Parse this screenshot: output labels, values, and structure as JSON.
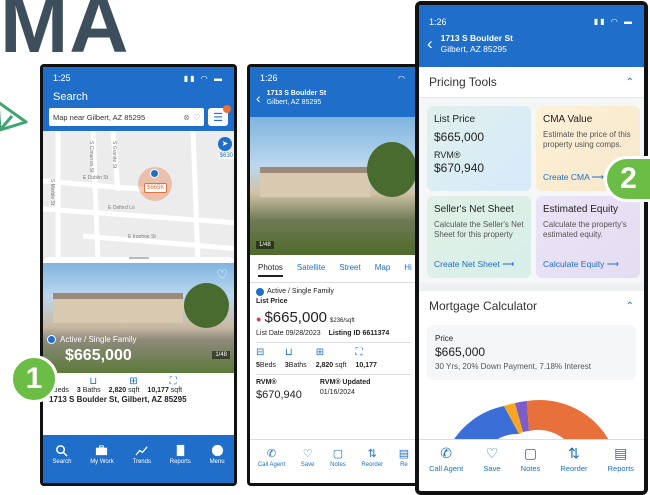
{
  "hero_title": "MA",
  "phone1": {
    "time": "1:25",
    "title": "Search",
    "search_text": "Map near Gilbert, AZ 85295",
    "filter_badge": "1",
    "map": {
      "price_pin": "$665K",
      "side_pin": "$630",
      "streets": [
        "S Granite St",
        "S Cimarron St",
        "S Marble St",
        "E Dublin St",
        "E Oxford Ln",
        "E Ironhoe St"
      ]
    },
    "listing": {
      "status": "Active / Single Family",
      "price": "$665,000",
      "photo_count": "1/48",
      "beds": "5",
      "beds_label": "Beds",
      "baths": "3",
      "baths_label": "Baths",
      "sqft": "2,820",
      "sqft_label": "sqft",
      "lot": "10,177",
      "lot_label": "sqft",
      "address": "1713 S Boulder St, Gilbert, AZ 85295"
    },
    "tabs": [
      "Search",
      "My Work",
      "Trends",
      "Reports",
      "Menu"
    ],
    "callout": "1"
  },
  "phone2": {
    "time": "1:26",
    "addr1": "1713 S Boulder St",
    "addr2": "Gilbert, AZ 85295",
    "photo_count": "1/48",
    "media_tabs": [
      "Photos",
      "Satellite",
      "Street",
      "Map",
      "Hi"
    ],
    "status": "Active / Single Family",
    "list_price_label": "List Price",
    "price": "$665,000",
    "per_sqft": "$236/sqft",
    "list_date": "List Date 09/28/2023",
    "listing_id": "Listing ID 6611374",
    "beds": "5",
    "beds_label": "Beds",
    "baths": "3",
    "baths_label": "Baths",
    "sqft": "2,820",
    "sqft_label": "sqft",
    "lot": "10,177",
    "rvm_label": "RVM®",
    "rvm_value": "$670,940",
    "rvm_updated_label": "RVM® Updated",
    "rvm_updated_date": "01/16/2024",
    "actions": [
      "Call Agent",
      "Save",
      "Notes",
      "Reorder",
      "Re"
    ]
  },
  "phone3": {
    "time": "1:26",
    "addr1": "1713 S Boulder St",
    "addr2": "Gilbert, AZ 85295",
    "pricing_tools": "Pricing Tools",
    "list_price_label": "List Price",
    "list_price": "$665,000",
    "rvm_label": "RVM®",
    "rvm_value": "$670,940",
    "cma_title": "CMA Value",
    "cma_desc": "Estimate the price of this property using comps.",
    "cma_link": "Create CMA",
    "seller_title": "Seller's Net Sheet",
    "seller_desc": "Calculate the Seller's Net Sheet for this property",
    "seller_link": "Create Net Sheet",
    "equity_title": "Estimated Equity",
    "equity_desc": "Calculate the property's estimated equity.",
    "equity_link": "Calculate Equity",
    "mortgage_title": "Mortgage Calculator",
    "price_label": "Price",
    "price_value": "$665,000",
    "loan_terms": "30 Yrs, 20% Down Payment, 7.18% Interest",
    "actions": [
      "Call Agent",
      "Save",
      "Notes",
      "Reorder",
      "Reports"
    ],
    "callout": "2"
  },
  "colors": {
    "brand_blue": "#1f6ec9",
    "callout_green": "#6cbd45",
    "pin_orange": "#e8703a"
  }
}
